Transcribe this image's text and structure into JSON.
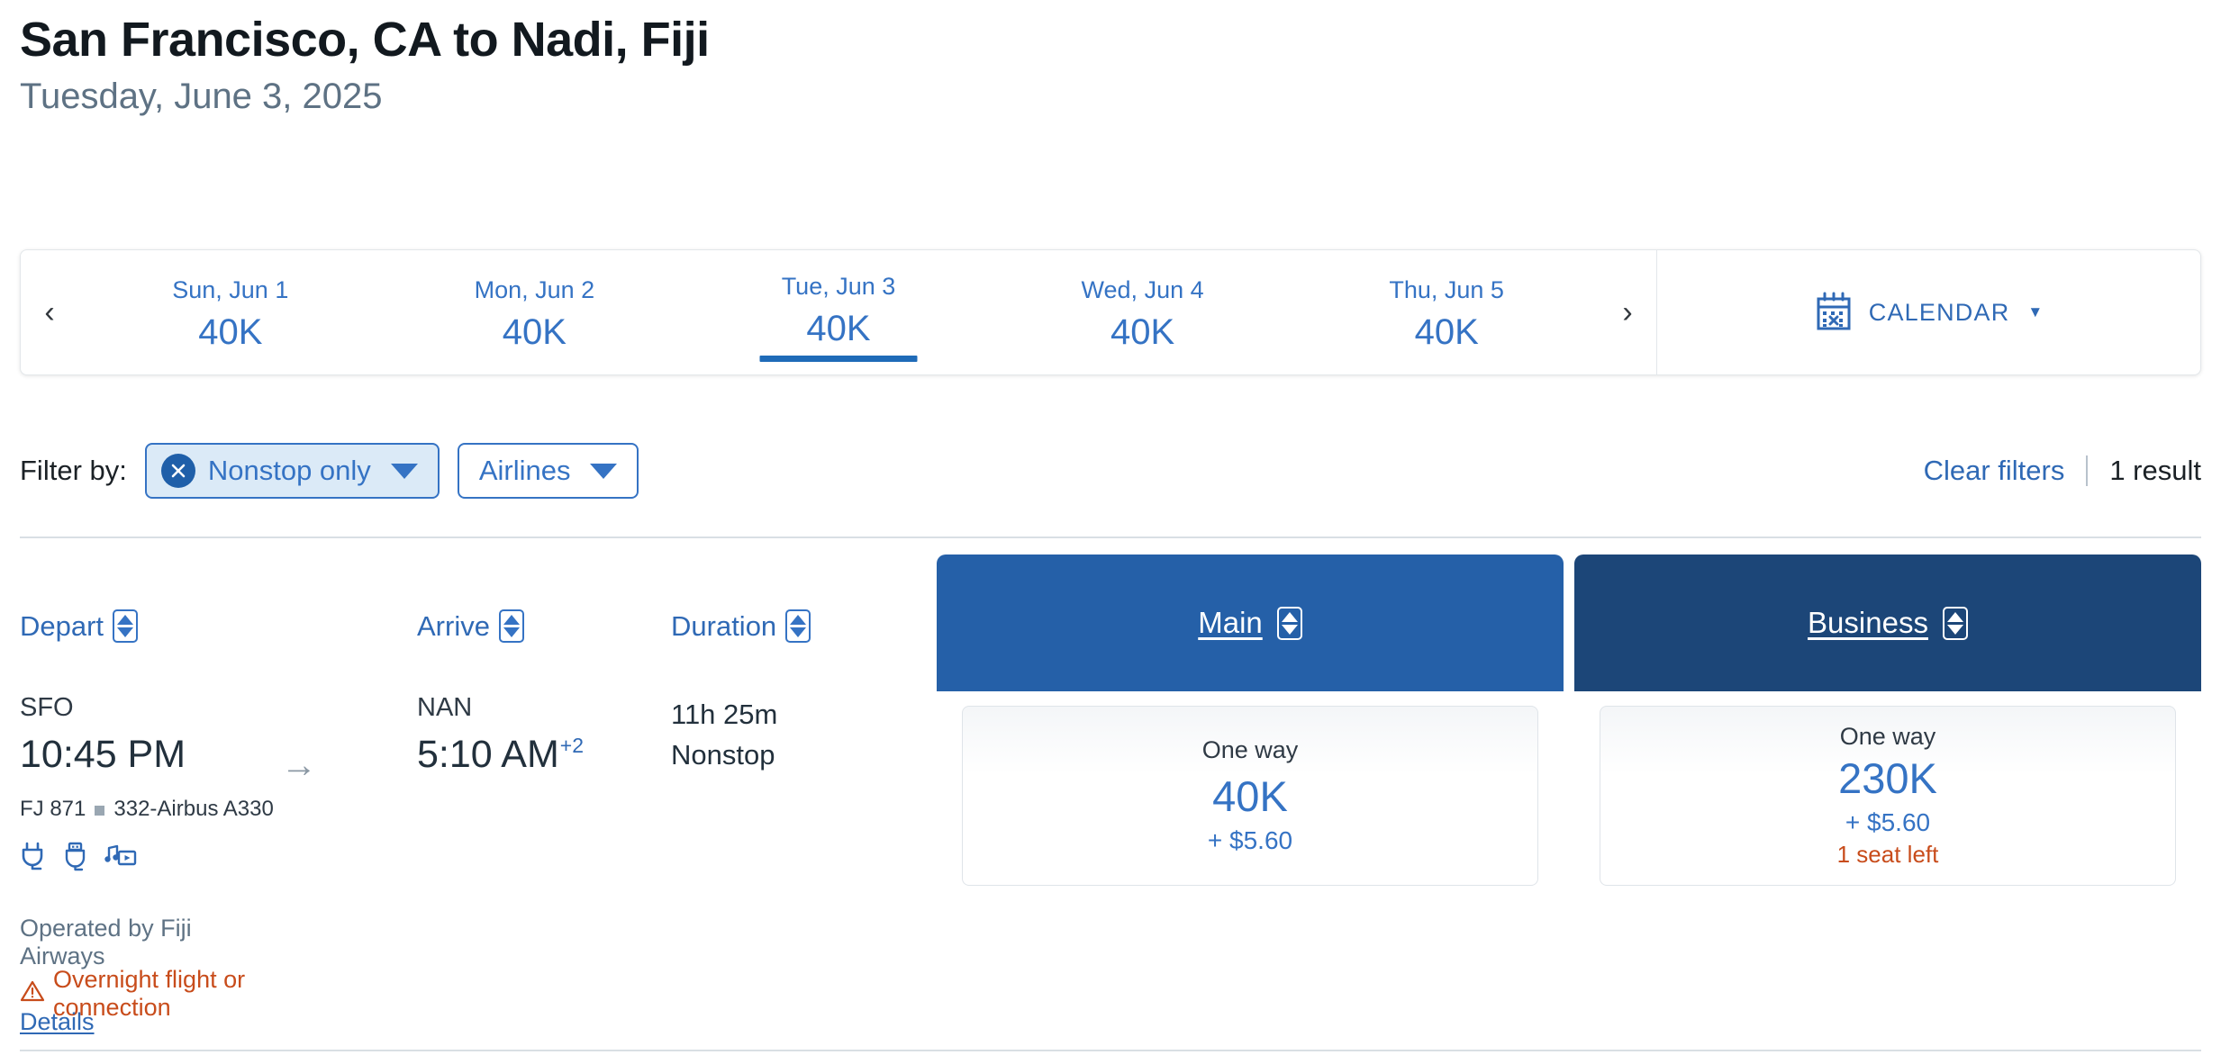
{
  "header": {
    "title": "San Francisco, CA to Nadi, Fiji",
    "subtitle": "Tuesday, June 3, 2025"
  },
  "date_strip": {
    "prev_label": "‹",
    "next_label": "›",
    "dates": [
      {
        "day": "Sun, Jun 1",
        "price": "40K",
        "selected": false
      },
      {
        "day": "Mon, Jun 2",
        "price": "40K",
        "selected": false
      },
      {
        "day": "Tue, Jun 3",
        "price": "40K",
        "selected": true
      },
      {
        "day": "Wed, Jun 4",
        "price": "40K",
        "selected": false
      },
      {
        "day": "Thu, Jun 5",
        "price": "40K",
        "selected": false
      }
    ],
    "calendar_label": "CALENDAR",
    "calendar_icon": "calendar-icon",
    "calendar_caret": "▼"
  },
  "filters": {
    "label": "Filter by:",
    "chips": [
      {
        "label": "Nonstop only",
        "active": true,
        "clear_icon": "close-circle-icon",
        "caret": "chevron-down-icon"
      },
      {
        "label": "Airlines",
        "active": false,
        "caret": "chevron-down-icon"
      }
    ],
    "clear_filters": "Clear filters",
    "separator": "|",
    "result_count": "1 result"
  },
  "table": {
    "columns": [
      {
        "label": "Depart",
        "sort_icon": "sort-updown-icon"
      },
      {
        "label": "Arrive",
        "sort_icon": "sort-updown-icon"
      },
      {
        "label": "Duration",
        "sort_icon": "sort-updown-icon"
      }
    ],
    "fare_classes": [
      {
        "label": "Main",
        "color": "#2560a8",
        "sort_icon": "sort-updown-icon"
      },
      {
        "label": "Business",
        "color": "#1c4678",
        "sort_icon": "sort-updown-icon"
      }
    ]
  },
  "flight": {
    "depart_airport": "SFO",
    "depart_time": "10:45 PM",
    "arrow": "→",
    "arrive_airport": "NAN",
    "arrive_time": "5:10 AM",
    "arrive_day_offset": "+2",
    "flight_number": "FJ 871",
    "aircraft": "332-Airbus A330",
    "amenities": [
      "power-outlet-icon",
      "usb-port-icon",
      "entertainment-icon"
    ],
    "duration": "11h 25m",
    "stops": "Nonstop",
    "operated_by": "Operated by Fiji Airways",
    "warning_icon": "warning-triangle-icon",
    "warning_text": "Overnight flight or connection",
    "details_label": "Details",
    "fares": [
      {
        "type": "One way",
        "price": "40K",
        "tax": "+ $5.60",
        "seats_left": ""
      },
      {
        "type": "One way",
        "price": "230K",
        "tax": "+ $5.60",
        "seats_left": "1 seat left"
      }
    ]
  },
  "colors": {
    "accent_blue": "#3573c4",
    "main_header": "#2560a8",
    "business_header": "#1c4678",
    "warning_orange": "#c84c1b",
    "muted_text": "#5e7284"
  }
}
